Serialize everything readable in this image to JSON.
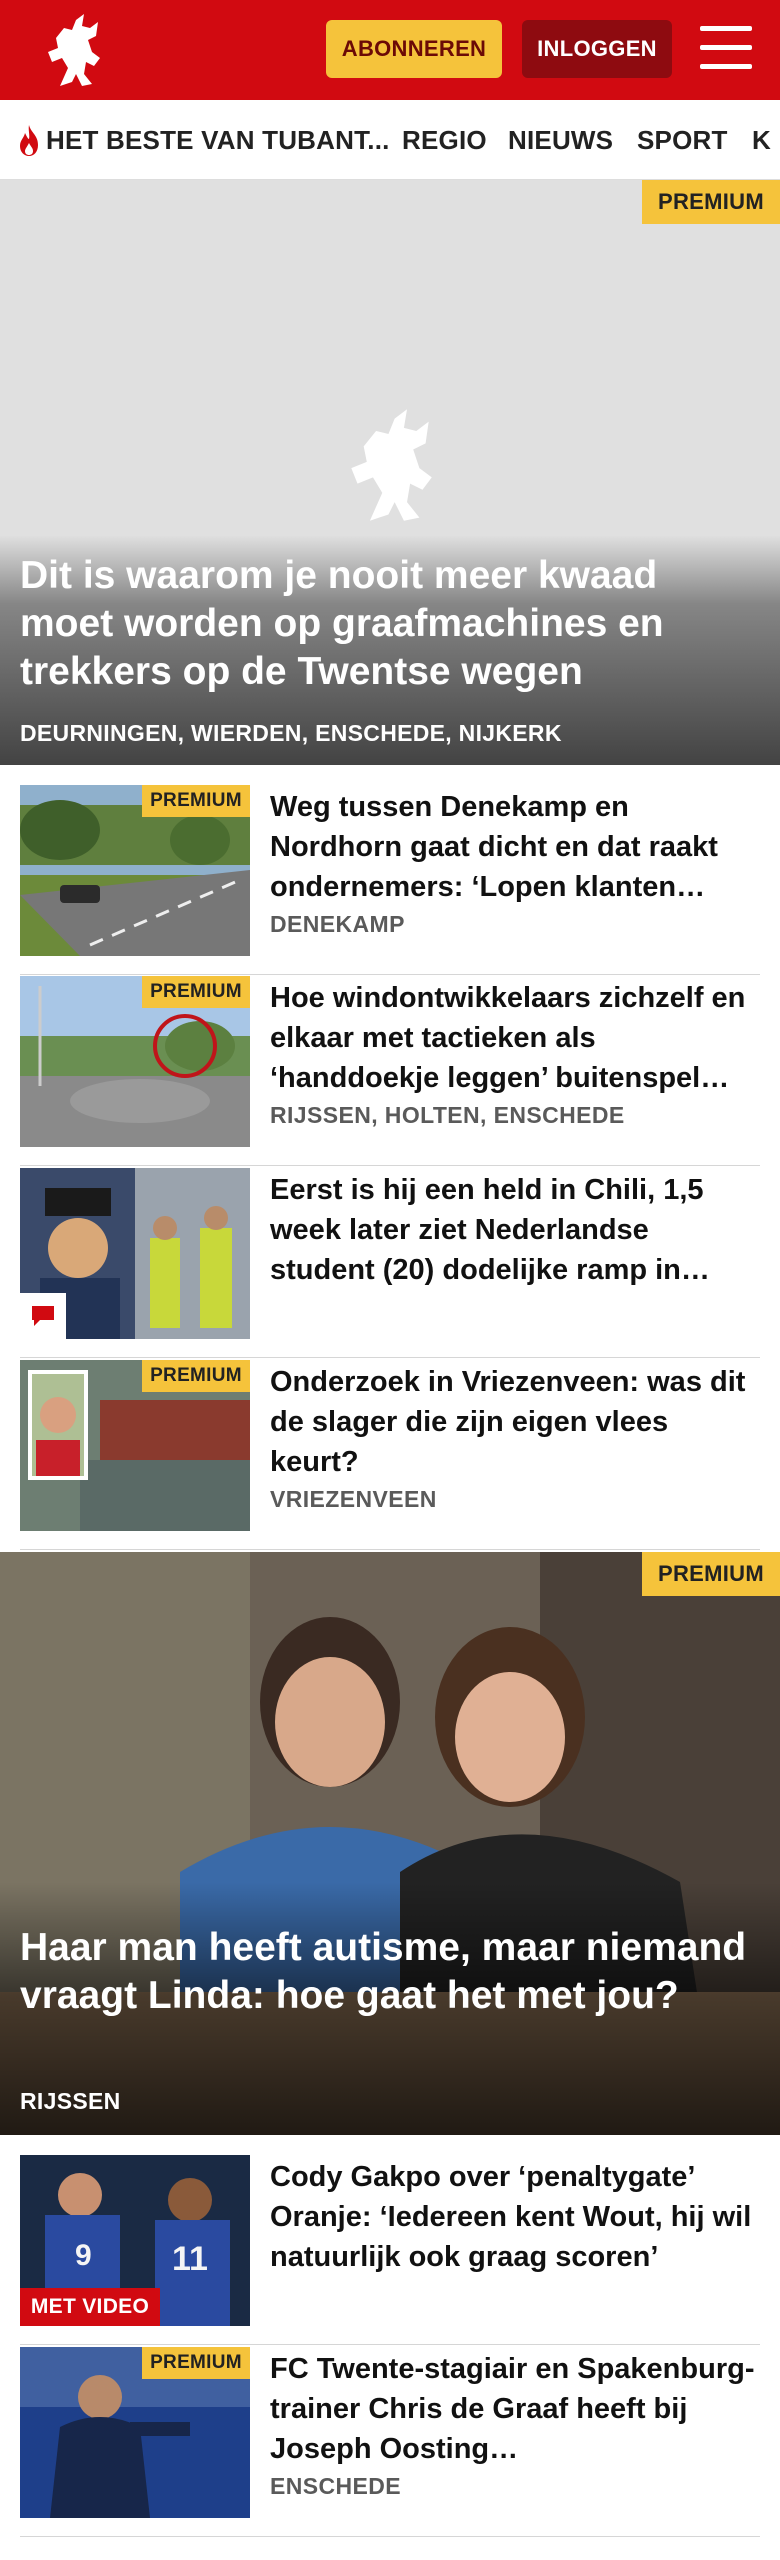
{
  "header": {
    "subscribe_label": "ABONNEREN",
    "login_label": "INLOGGEN",
    "brand_color": "#d10a11"
  },
  "nav": {
    "items": [
      {
        "label": "HET BESTE VAN TUBANT..."
      },
      {
        "label": "REGIO"
      },
      {
        "label": "NIEUWS"
      },
      {
        "label": "SPORT"
      },
      {
        "label": "K"
      }
    ]
  },
  "premium_label": "PREMIUM",
  "hero1": {
    "title": "Dit is waarom je nooit meer kwaad moet worden op graafmachines en trekkers op de Twentse wegen",
    "location": "DEURNINGEN, WIERDEN, ENSCHEDE, NIJKERK"
  },
  "articles1": [
    {
      "headline": "Weg tussen Denekamp en Nordhorn gaat dicht en dat raakt ondernemers: ‘Lopen klanten…",
      "location": "DENEKAMP"
    },
    {
      "headline": "Hoe windontwikkelaars zichzelf en elkaar met tactieken als ‘handdoekje leggen’ buitenspel…",
      "location": "RIJSSEN, HOLTEN, ENSCHEDE"
    },
    {
      "headline": "Eerst is hij een held in Chili, 1,5 week later ziet Nederlandse student (20) dodelijke ramp in…",
      "location": ""
    },
    {
      "headline": "Onderzoek in Vriezenveen: was dit de slager die zijn eigen vlees keurt?",
      "location": "VRIEZENVEEN"
    }
  ],
  "hero2": {
    "title": "Haar man heeft autisme, maar niemand vraagt Linda: hoe gaat het met jou?",
    "location": "RIJSSEN"
  },
  "articles2": [
    {
      "headline": "Cody Gakpo over ‘penaltygate’ Oranje: ‘Iedereen kent Wout, hij wil natuurlijk ook graag scoren’",
      "location": "",
      "badge": "MET VIDEO"
    },
    {
      "headline": "FC Twente-stagiair en Spakenburg-trainer Chris de Graaf heeft bij Joseph Oosting…",
      "location": "ENSCHEDE"
    }
  ]
}
